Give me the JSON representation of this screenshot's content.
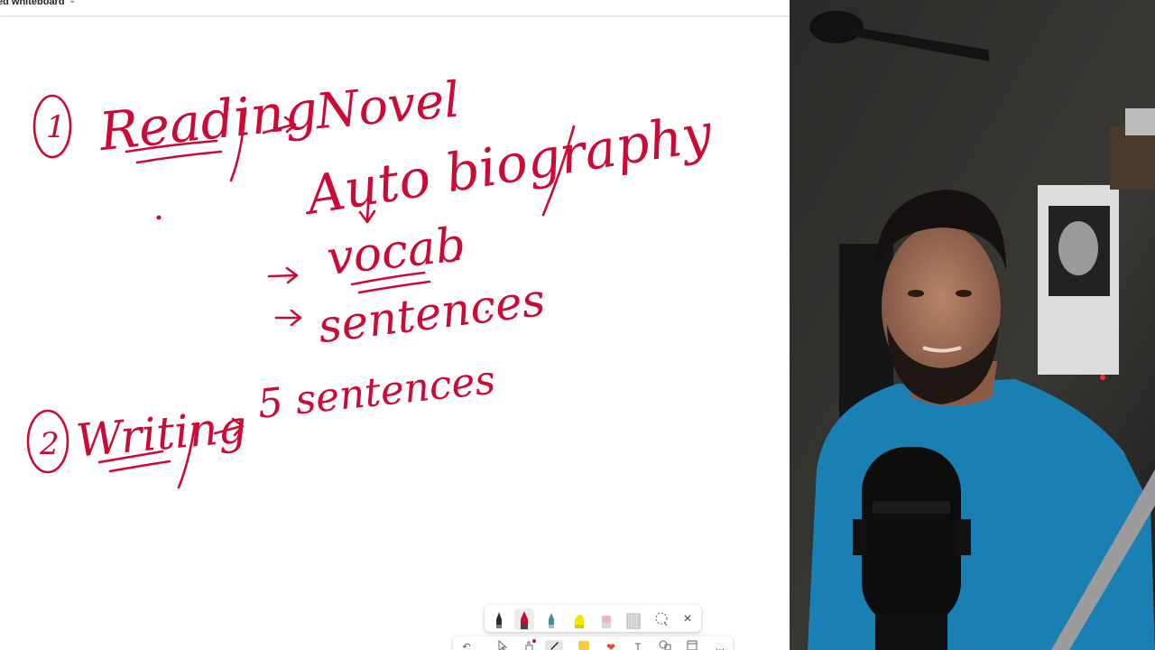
{
  "app": {
    "title": "ed whiteboard"
  },
  "whiteboard": {
    "ink_color": "#cc0a36",
    "items": [
      {
        "marker": "1",
        "word": "Reading",
        "arrow": "→"
      },
      {
        "word": "Novel",
        "punct": ","
      },
      {
        "word": "Auto biography"
      },
      {
        "word": "vocab",
        "punct": "."
      },
      {
        "word": "sentences",
        "punct": "."
      },
      {
        "marker": "2",
        "word": "Writing",
        "arrow": "→"
      },
      {
        "word": "5 sentences"
      }
    ]
  },
  "pen_tray": {
    "tools": [
      {
        "name": "pen-black",
        "color": "#1e1e1e",
        "selected": false
      },
      {
        "name": "pen-red",
        "color": "#cc0a36",
        "selected": true
      },
      {
        "name": "pen-teal",
        "color": "#3d8fa0",
        "selected": false
      },
      {
        "name": "highlighter-yellow",
        "color": "#f5e800",
        "selected": false
      },
      {
        "name": "eraser",
        "color": "#f0b6bd",
        "selected": false
      },
      {
        "name": "ruler",
        "color": "#bdbdbd",
        "selected": false
      }
    ],
    "close_glyph": "×"
  },
  "toolbar": {
    "undo_glyph": "↶",
    "text_glyph": "T",
    "more_glyph": "…"
  },
  "webcam": {
    "shirt_color": "#1a7fb3"
  }
}
